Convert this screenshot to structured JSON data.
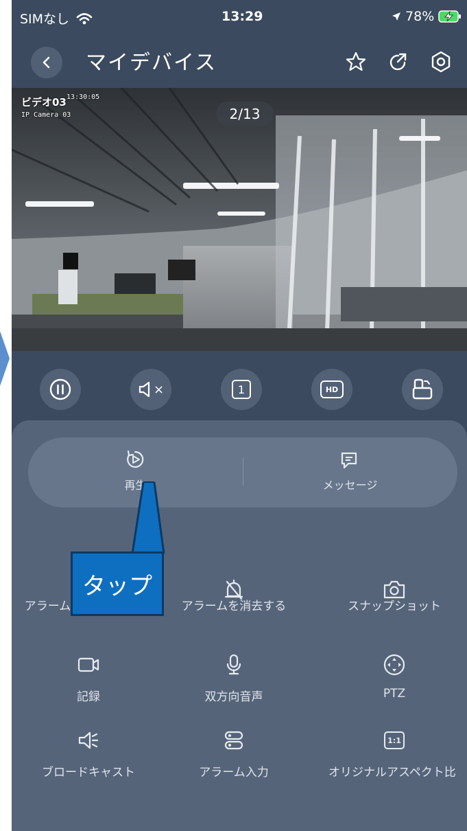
{
  "status_bar": {
    "carrier": "SIMなし",
    "time": "13:29",
    "battery": "78%"
  },
  "nav": {
    "title": "マイデバイス",
    "back_icon": "chevron-left-icon",
    "icons": [
      "star-icon",
      "share-icon",
      "settings-icon"
    ]
  },
  "video": {
    "overlay_name": "ビデオ03",
    "overlay_timestamp": "13:30:05",
    "overlay_camera": "IP Camera 03",
    "page_indicator": "2/13"
  },
  "controls": [
    {
      "name": "pause-button",
      "icon": "pause-icon",
      "label": ""
    },
    {
      "name": "mute-button",
      "icon": "speaker-mute-icon",
      "label": "×"
    },
    {
      "name": "split-button",
      "icon": "split-view-icon",
      "label": "1"
    },
    {
      "name": "hd-button",
      "icon": "hd-icon",
      "label": "HD"
    },
    {
      "name": "fullscreen-button",
      "icon": "rotate-screen-icon",
      "label": ""
    }
  ],
  "pill": {
    "playback": "再生",
    "message": "メッセージ"
  },
  "features": {
    "trigger_alarm": "アラームをトリガーする",
    "clear_alarm": "アラームを消去する",
    "snapshot": "スナップショット",
    "record": "記録",
    "two_way_audio": "双方向音声",
    "ptz": "PTZ",
    "broadcast": "ブロードキャスト",
    "alarm_input": "アラーム入力",
    "aspect_ratio": "オリジナルアスペクト比",
    "aspect_icon_text": "1:1"
  },
  "callout": {
    "text": "タップ"
  },
  "colors": {
    "background": "#3b4a5e",
    "panel": "#56647a",
    "callout": "#0e6fc0"
  }
}
